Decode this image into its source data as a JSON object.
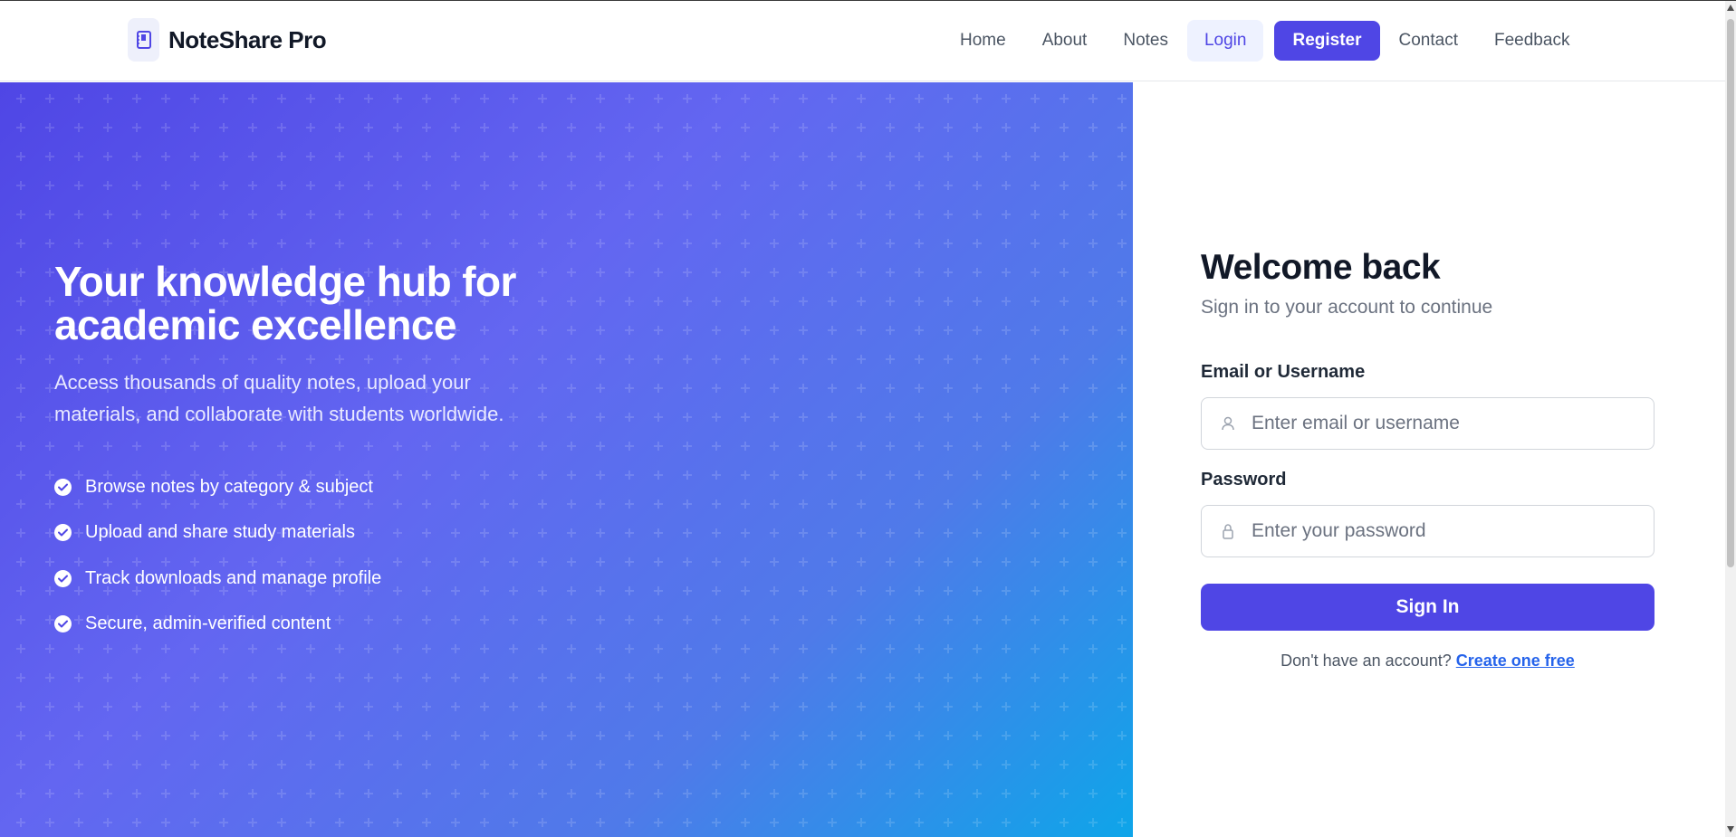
{
  "brand": {
    "name": "NoteShare Pro",
    "icon": "notebook-icon"
  },
  "nav": {
    "items": [
      {
        "label": "Home"
      },
      {
        "label": "About"
      },
      {
        "label": "Notes"
      },
      {
        "label": "Login",
        "state": "active"
      },
      {
        "label": "Register",
        "style": "primary"
      },
      {
        "label": "Contact"
      },
      {
        "label": "Feedback"
      }
    ]
  },
  "hero": {
    "title": "Your knowledge hub for academic excellence",
    "subtitle": "Access thousands of quality notes, upload your materials, and collaborate with students worldwide.",
    "features": [
      "Browse notes by category & subject",
      "Upload and share study materials",
      "Track downloads and manage profile",
      "Secure, admin-verified content"
    ]
  },
  "login": {
    "title": "Welcome back",
    "subtitle": "Sign in to your account to continue",
    "email_label": "Email or Username",
    "email_placeholder": "Enter email or username",
    "email_value": "",
    "password_label": "Password",
    "password_placeholder": "Enter your password",
    "password_value": "",
    "submit_label": "Sign In",
    "register_prompt": "Don't have an account?",
    "register_link": "Create one free"
  },
  "colors": {
    "accent": "#4f46e5",
    "hero_gradient_start": "#4f46e5",
    "hero_gradient_end": "#0ea5e9",
    "link": "#2563eb"
  }
}
